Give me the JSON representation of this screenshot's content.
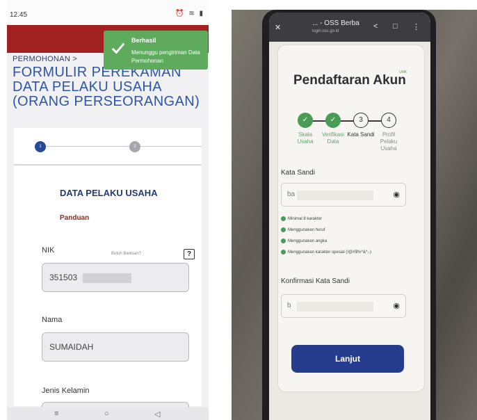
{
  "left": {
    "status_time": "12.45",
    "status_icons": "⏰ ≋ ▮",
    "toast": {
      "title": "Berhasil",
      "message": "Menunggu pengiriman Data Permohonan"
    },
    "breadcrumb": "PERMOHONAN  >",
    "form_title": "FORMULIR PEREKAMAN DATA PELAKU USAHA (ORANG PERSEORANGAN)",
    "steps": [
      "1",
      "2"
    ],
    "section_title": "DATA PELAKU USAHA",
    "panduan_label": "Panduan",
    "nik_label": "NIK",
    "nik_value": "351503",
    "nama_label": "Nama",
    "nama_value": "SUMAIDAH",
    "jenis_kelamin_label": "Jenis Kelamin",
    "help_text": "Butuh Bantuan?",
    "help_button": "?",
    "nav_buttons": [
      "≡",
      "○",
      "◁"
    ],
    "colors": {
      "top_band": "#a12121",
      "title": "#2b56a8",
      "toast": "#5eab5e"
    }
  },
  "right": {
    "browser_title": "... - OSS Berba",
    "browser_url": "login.oss.go.id",
    "page_title": "Pendaftaran Akun",
    "badge": "UMK",
    "steps": [
      {
        "num": "✓",
        "label": "Skala Usaha",
        "state": "done"
      },
      {
        "num": "✓",
        "label": "Verifikasi Data",
        "state": "done"
      },
      {
        "num": "3",
        "label": "Kata Sandi",
        "state": "current"
      },
      {
        "num": "4",
        "label": "Profil Pelaku Usaha",
        "state": "todo"
      }
    ],
    "password_label": "Kata Sandi",
    "password_value": "ba",
    "requirements": [
      "Minimal 8 karakter",
      "Menggunakan huruf",
      "Menggunakan angka",
      "Menggunakan karakter spesial (!@#$%^&*,-)"
    ],
    "confirm_label": "Konfirmasi Kata Sandi",
    "confirm_value": "b",
    "submit_button": "Lanjut",
    "colors": {
      "button": "#253d8c",
      "check": "#4a9b53"
    }
  }
}
